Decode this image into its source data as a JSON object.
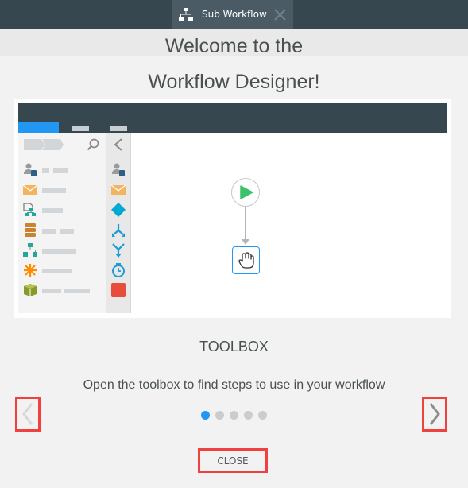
{
  "tab": {
    "icon": "sitemap-icon",
    "label": "Sub Workflow",
    "close_icon": "close-icon"
  },
  "welcome": {
    "title_line1": "Welcome to the",
    "title_line2": "Workflow Designer!"
  },
  "illustration": {
    "toolbox_items": [
      {
        "icon": "user-assign-icon",
        "color": "#8a8a8a"
      },
      {
        "icon": "email-icon",
        "color": "#f0b35c"
      },
      {
        "icon": "form-workflow-icon",
        "color": "#26a69a"
      },
      {
        "icon": "database-icon",
        "color": "#c57d2e"
      },
      {
        "icon": "sitemap-icon",
        "color": "#26a69a"
      },
      {
        "icon": "asterisk-icon",
        "color": "#ff8c00"
      },
      {
        "icon": "package-icon",
        "color": "#8a9a2a"
      }
    ],
    "collapsed_items": [
      {
        "icon": "user-assign-icon",
        "color": "#8a8a8a"
      },
      {
        "icon": "email-icon",
        "color": "#f0b35c"
      },
      {
        "icon": "decision-diamond-icon",
        "color": "#00a8d4"
      },
      {
        "icon": "split-icon",
        "color": "#1e9bd7"
      },
      {
        "icon": "merge-icon",
        "color": "#1e9bd7"
      },
      {
        "icon": "timer-icon",
        "color": "#1e9bd7"
      },
      {
        "icon": "stop-icon",
        "color": "#e74c3c"
      }
    ],
    "start_node_icon": "play-icon",
    "drop_node_icon": "hand-pointer-icon",
    "accent": "#2196f3"
  },
  "step": {
    "title": "TOOLBOX",
    "description": "Open the toolbox to find steps to use in your workflow",
    "current_index": 1,
    "total": 5
  },
  "nav": {
    "prev_icon": "chevron-left-icon",
    "next_icon": "chevron-right-icon"
  },
  "close_label": "CLOSE",
  "colors": {
    "header_bg": "#37474f",
    "highlight_border": "#f04040",
    "active_dot": "#2196f3"
  }
}
